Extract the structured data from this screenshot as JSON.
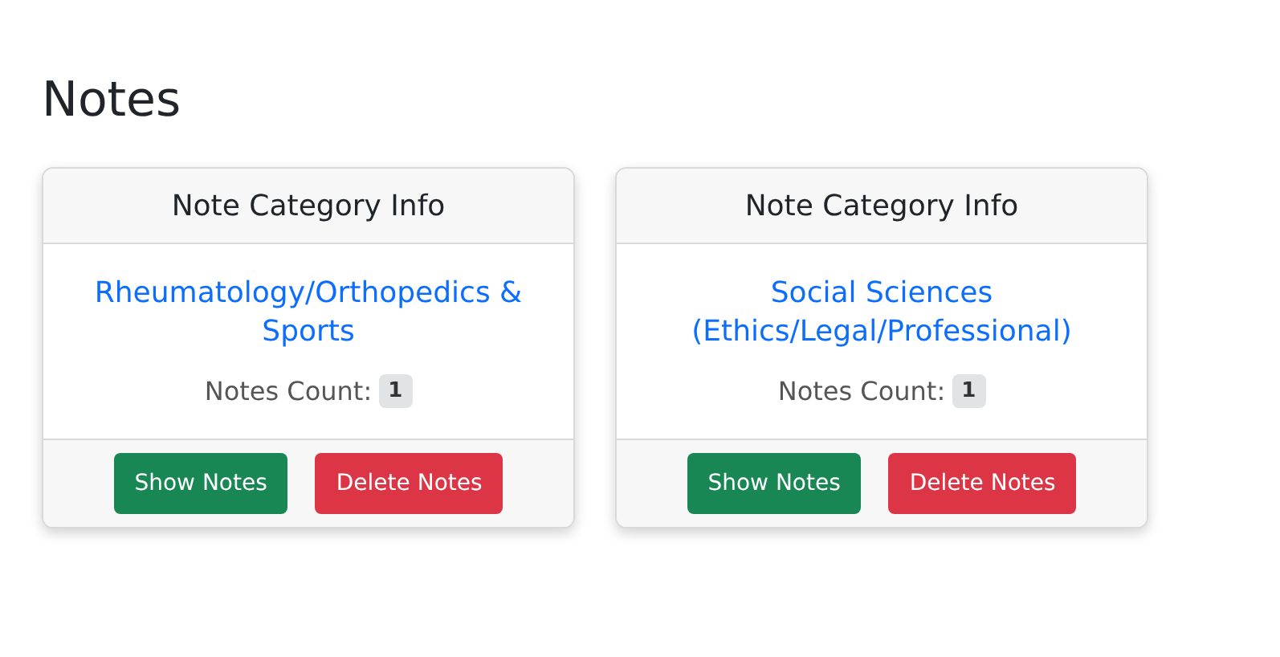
{
  "heading": "Notes",
  "cards": [
    {
      "header": "Note Category Info",
      "category": "Rheumatology/Orthopedics & Sports",
      "count_label": "Notes Count:",
      "count": "1",
      "buttons": [
        {
          "label": "Show Notes",
          "kind": "success"
        },
        {
          "label": "Delete Notes",
          "kind": "danger"
        }
      ]
    },
    {
      "header": "Note Category Info",
      "category": "Social Sciences (Ethics/Legal/Professional)",
      "count_label": "Notes Count:",
      "count": "1",
      "buttons": [
        {
          "label": "Show Notes",
          "kind": "success"
        },
        {
          "label": "Delete Notes",
          "kind": "danger"
        }
      ]
    }
  ]
}
